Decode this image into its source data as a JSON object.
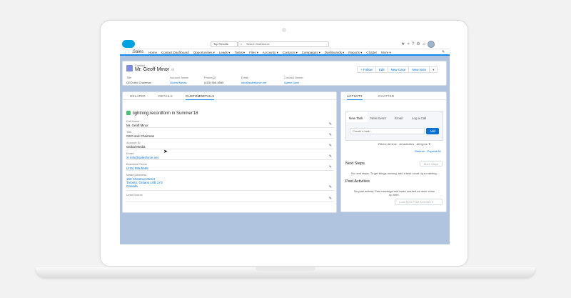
{
  "header": {
    "search_scope": "Top Results",
    "search_placeholder": "Search Salesforce",
    "icons": [
      "star-icon",
      "add-icon",
      "help-icon",
      "setup-gear-icon",
      "notifications-bell-icon",
      "avatar"
    ]
  },
  "nav": {
    "app_name": "Sales",
    "items": [
      "Home",
      "Contact Dashboard",
      "Opportunities",
      "Leads",
      "Tasks",
      "Files",
      "Accounts",
      "Contacts",
      "Campaigns",
      "Dashboards",
      "Reports",
      "Chatter",
      "More"
    ],
    "active": "Contacts"
  },
  "record": {
    "object": "Contact",
    "name": "Mr. Geoff Minor",
    "buttons": [
      "+ Follow",
      "Edit",
      "New Case",
      "New Note"
    ],
    "fields": [
      {
        "label": "Title",
        "value": "CEO and Chairman"
      },
      {
        "label": "Account Name",
        "value": "Global Media"
      },
      {
        "label": "Phone(2)",
        "value": "(415) 555-5555"
      },
      {
        "label": "Email",
        "value": "info@salesforce.net"
      },
      {
        "label": "Contact Owner",
        "value": "Admin User"
      }
    ]
  },
  "left_tabs": [
    "RELATED",
    "DETAILS",
    "CUSTOMDETAILS"
  ],
  "left_tab_active": "CUSTOMDETAILS",
  "lightning_heading": "lightning:recordform in Summer'18",
  "form_fields": {
    "full_name": {
      "label": "Full Name",
      "value": "Mr. Geoff Minor"
    },
    "title": {
      "label": "Title",
      "value": "CEO and Chairman"
    },
    "account": {
      "label": "Account ID",
      "value": "Global Media"
    },
    "email": {
      "label": "Email",
      "value": "info@salesforce.net"
    },
    "phone": {
      "label": "Business Phone",
      "value": "(415) 555-5555"
    },
    "address": {
      "label": "Mailing Address",
      "line1": "150 Chestnut Street",
      "line2": "Toronto, Ontario L4B 1Y3",
      "line3": "Canada"
    },
    "lead_source": {
      "label": "Lead Source",
      "value": ""
    }
  },
  "right_tabs": [
    "ACTIVITY",
    "CHATTER"
  ],
  "activity": {
    "subtabs": [
      "New Task",
      "New Event",
      "Email",
      "Log a Call"
    ],
    "task_placeholder": "Create a task...",
    "add_label": "Add",
    "filters": "Filters: All time · All activities · All types",
    "refresh": "Refresh · Expand All",
    "next_steps_title": "Next Steps",
    "more_steps_label": "More Steps",
    "next_steps_empty": "No next steps. To get things moving, add a task or set up a meeting.",
    "past_title": "Past Activities",
    "past_empty": "No past activity. Past meetings and tasks marked as done show up here.",
    "load_more": "Load More Past Activities"
  }
}
